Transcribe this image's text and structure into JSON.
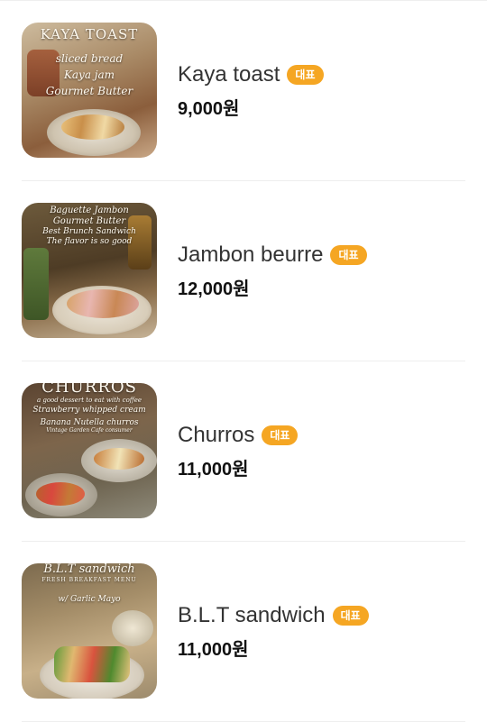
{
  "menu": {
    "items": [
      {
        "name": "Kaya toast",
        "badge": "대표",
        "price": "9,000원",
        "image_text": [
          "KAYA TOAST",
          "sliced bread",
          "Kaya jam",
          "Gourmet Butter"
        ]
      },
      {
        "name": "Jambon beurre",
        "badge": "대표",
        "price": "12,000원",
        "image_text": [
          "Baguette Jambon",
          "Gourmet Butter",
          "Best Brunch Sandwich",
          "The flavor is so good"
        ]
      },
      {
        "name": "Churros",
        "badge": "대표",
        "price": "11,000원",
        "image_text": [
          "CHURROS",
          "a good dessert to eat with coffee",
          "Strawberry whipped cream",
          "Banana Nutella churros",
          "Vintage Garden Cafe consumer"
        ]
      },
      {
        "name": "B.L.T sandwich",
        "badge": "대표",
        "price": "11,000원",
        "image_text": [
          "B.L.T sandwich",
          "FRESH BREAKFAST MENU",
          "w/ Garlic Mayo"
        ]
      }
    ]
  },
  "colors": {
    "badge": "#f5a623",
    "divider": "#eeeeee",
    "name_text": "#333333",
    "price_text": "#111111"
  }
}
